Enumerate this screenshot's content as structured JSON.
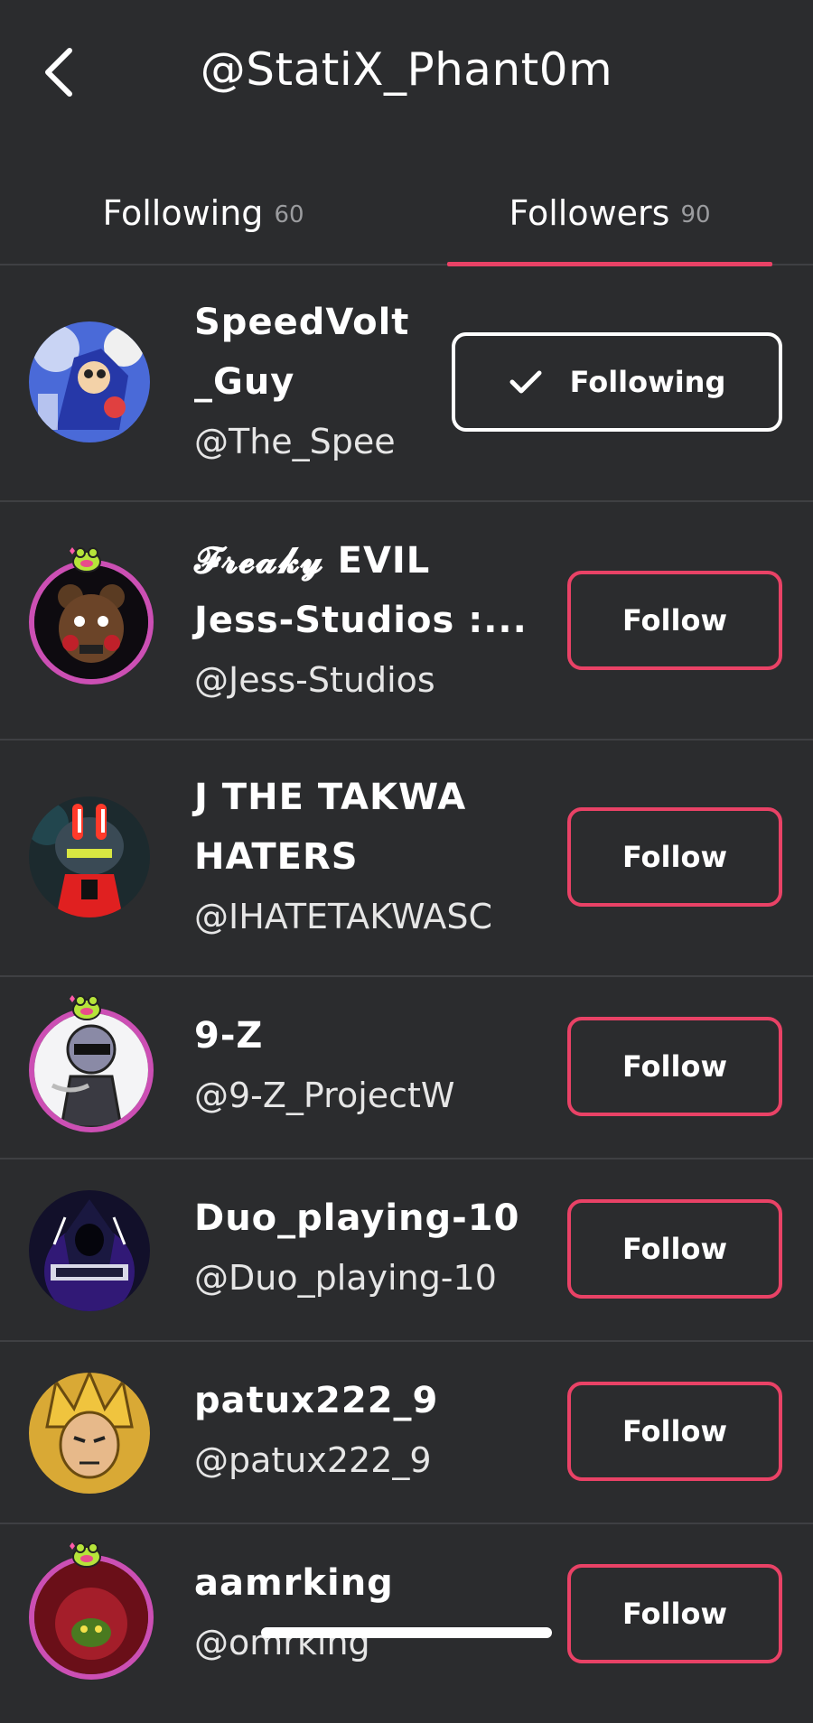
{
  "header": {
    "title": "@StatiX_Phant0m",
    "back_icon": "chevron-left-icon"
  },
  "tabs": [
    {
      "label": "Following",
      "count": "60",
      "active": false
    },
    {
      "label": "Followers",
      "count": "90",
      "active": true
    }
  ],
  "accent_color": "#e94266",
  "users": [
    {
      "name_line1": "SpeedVolt",
      "name_line2": "_Guy",
      "handle": "@The_Spee",
      "button": "Following",
      "avatar": "blue-hedgehog-avatar"
    },
    {
      "name_line1": "𝓕𝓻𝓮𝓪𝓴𝔂 EVIL",
      "name_line2": "Jess-Studios :...",
      "handle": "@Jess-Studios",
      "button": "Follow",
      "avatar": "animatronic-bear-avatar"
    },
    {
      "name_line1": "J THE TAKWA",
      "name_line2": "HATERS",
      "handle": "@IHATETAKWASC",
      "button": "Follow",
      "avatar": "robot-avatar"
    },
    {
      "name_line1": "9-Z",
      "handle": "@9-Z_ProjectW",
      "button": "Follow",
      "avatar": "hooded-character-avatar"
    },
    {
      "name_line1": "Duo_playing-10",
      "handle": "@Duo_playing-10",
      "button": "Follow",
      "avatar": "gaming-logo-avatar"
    },
    {
      "name_line1": "patux222_9",
      "handle": "@patux222_9",
      "button": "Follow",
      "avatar": "anime-fighter-avatar"
    },
    {
      "name_line1": "aamrking",
      "handle": "@omrking",
      "button": "Follow",
      "avatar": "red-creature-avatar"
    }
  ]
}
